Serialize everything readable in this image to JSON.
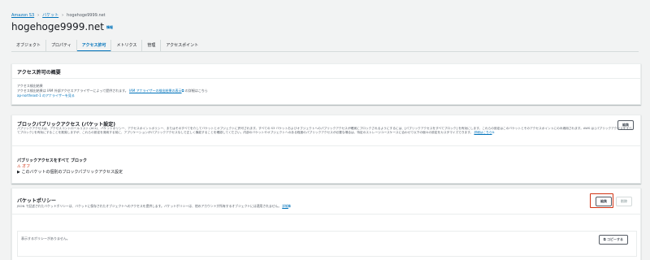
{
  "breadcrumb": {
    "root": "Amazon S3",
    "buckets": "バケット",
    "current": "hogehoge9999.net"
  },
  "page": {
    "title": "hogehoge9999.net",
    "info": "情報"
  },
  "tabs": [
    {
      "label": "オブジェクト",
      "active": false
    },
    {
      "label": "プロパティ",
      "active": false
    },
    {
      "label": "アクセス許可",
      "active": true
    },
    {
      "label": "メトリクス",
      "active": false
    },
    {
      "label": "管理",
      "active": false
    },
    {
      "label": "アクセスポイント",
      "active": false
    }
  ],
  "overview": {
    "heading": "アクセス許可の概要",
    "analyzer_label": "アクセス検出結果",
    "analyzer_desc": "アクセス検出結果は IAM 外部アクセスアナライザーによって提供されます。",
    "analyzer_link": "IAM アナライザーの検出結果の表示",
    "analyzer_suffix": "の詳細はこちら",
    "analyzer_region_link": "ap-northeast-1 のアナライザーを見る"
  },
  "block_public": {
    "heading": "ブロックパブリックアクセス (バケット設定)",
    "desc": "パブリックアクセスは、アクセスコントロールリスト (ACL)、バケットポリシー、アクセスポイントポリシー、またはそのすべてを介してバケットとオブジェクトに許可されます。すべての S3 バケットおよびオブジェクトへのパブリックアクセスが確実にブロックされるようにするには、[パブリックアクセスをすべてブロック] を有効にします。これらの設定はこのバケットとそのアクセスポイントにのみ適用されます。AWS は [パブリックアクセスをすべてブロック] を有効にすることを推奨しますが、これらの設定を適用する前に、アプリケーションがパブリックアクセスなしで正しく機能することを確認してください。内部のバケットやオブジェクトへのある程度のパブリックアクセスが必要な場合は、特定のストレージユースケースに合わせて以下の個々の設定をカスタマイズできます。",
    "desc_link": "詳細はこちら",
    "edit_label": "編集",
    "all_label": "パブリックアクセスをすべて ブロック",
    "status": "オフ",
    "expand_label": "このバケットの個別のブロックパブリックアクセス設定"
  },
  "policy": {
    "heading": "バケットポリシー",
    "desc": "JSON で記述されたバケットポリシーは、バケットに保存されたオブジェクトへのアクセスを提供します。バケットポリシーは、他のアカウントが所有するオブジェクトには適用されません。",
    "desc_link": "詳細",
    "edit_label": "編集",
    "delete_label": "削除",
    "empty_text": "表示するポリシーがありません。",
    "copy_label": "コピーする"
  }
}
